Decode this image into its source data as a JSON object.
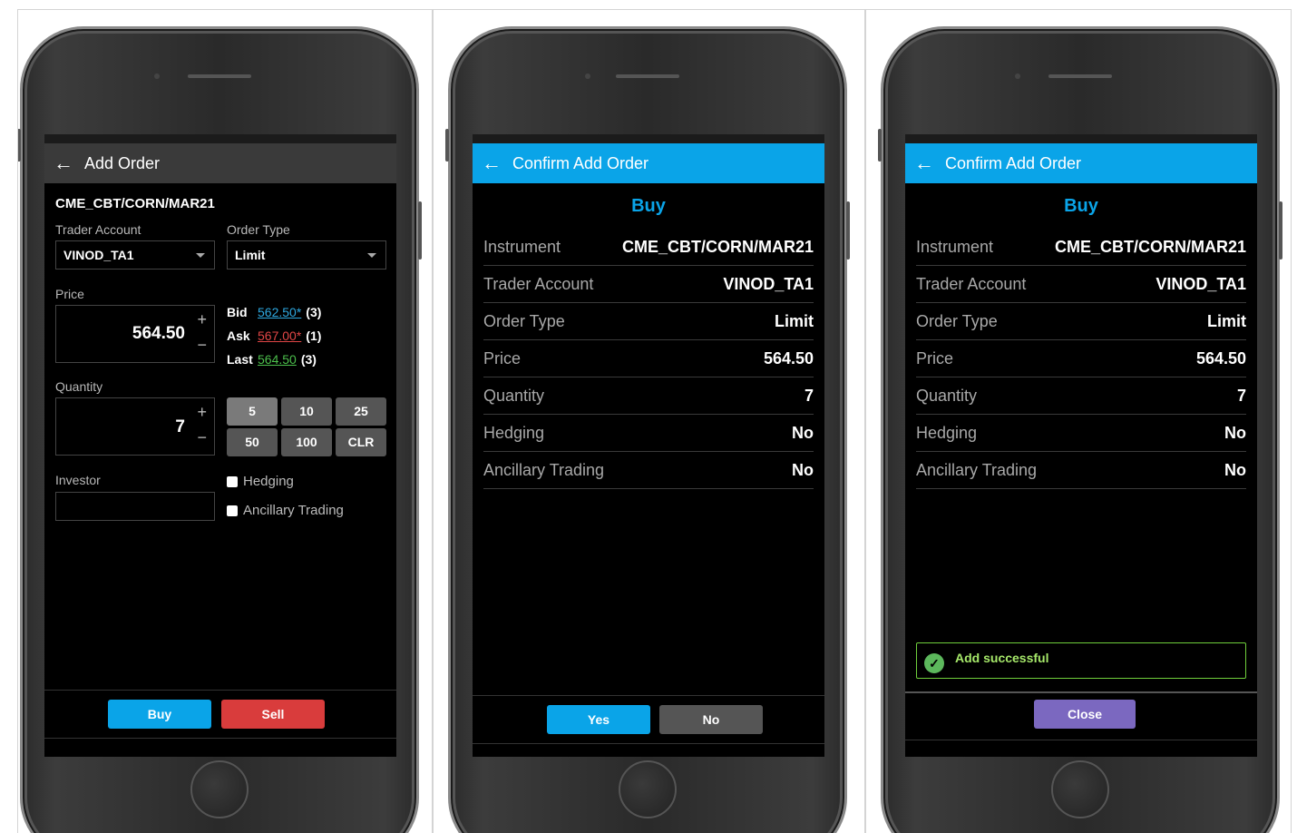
{
  "panel1": {
    "title": "Add Order",
    "instrument": "CME_CBT/CORN/MAR21",
    "trader_account_label": "Trader Account",
    "trader_account_value": "VINOD_TA1",
    "order_type_label": "Order Type",
    "order_type_value": "Limit",
    "price_label": "Price",
    "price_value": "564.50",
    "plus": "+",
    "minus": "−",
    "bid_label": "Bid",
    "bid_price": "562.50*",
    "bid_qty": "(3)",
    "ask_label": "Ask",
    "ask_price": "567.00*",
    "ask_qty": "(1)",
    "last_label": "Last",
    "last_price": "564.50",
    "last_qty": "(3)",
    "quantity_label": "Quantity",
    "quantity_value": "7",
    "qty_buttons": [
      "5",
      "10",
      "25",
      "50",
      "100",
      "CLR"
    ],
    "investor_label": "Investor",
    "investor_value": "",
    "hedging_label": "Hedging",
    "ancillary_label": "Ancillary Trading",
    "buy_label": "Buy",
    "sell_label": "Sell"
  },
  "panel2": {
    "title": "Confirm Add Order",
    "side": "Buy",
    "rows": [
      {
        "label": "Instrument",
        "value": "CME_CBT/CORN/MAR21"
      },
      {
        "label": "Trader Account",
        "value": "VINOD_TA1"
      },
      {
        "label": "Order Type",
        "value": "Limit"
      },
      {
        "label": "Price",
        "value": "564.50"
      },
      {
        "label": "Quantity",
        "value": "7"
      },
      {
        "label": "Hedging",
        "value": "No"
      },
      {
        "label": "Ancillary Trading",
        "value": "No"
      }
    ],
    "yes_label": "Yes",
    "no_label": "No"
  },
  "panel3": {
    "title": "Confirm Add Order",
    "side": "Buy",
    "rows": [
      {
        "label": "Instrument",
        "value": "CME_CBT/CORN/MAR21"
      },
      {
        "label": "Trader Account",
        "value": "VINOD_TA1"
      },
      {
        "label": "Order Type",
        "value": "Limit"
      },
      {
        "label": "Price",
        "value": "564.50"
      },
      {
        "label": "Quantity",
        "value": "7"
      },
      {
        "label": "Hedging",
        "value": "No"
      },
      {
        "label": "Ancillary Trading",
        "value": "No"
      }
    ],
    "toast": "Add successful",
    "close_label": "Close"
  },
  "colors": {
    "accent_blue": "#0aa4e8",
    "sell_red": "#d93c3c",
    "bid_blue": "#2ea8e0",
    "ask_red": "#e04646",
    "last_green": "#4cbf4c",
    "close_purple": "#7b68c0",
    "success_green": "#6fcf3b"
  },
  "icons": [
    "back-arrow-icon",
    "caret-down-icon",
    "check-circle-icon"
  ]
}
